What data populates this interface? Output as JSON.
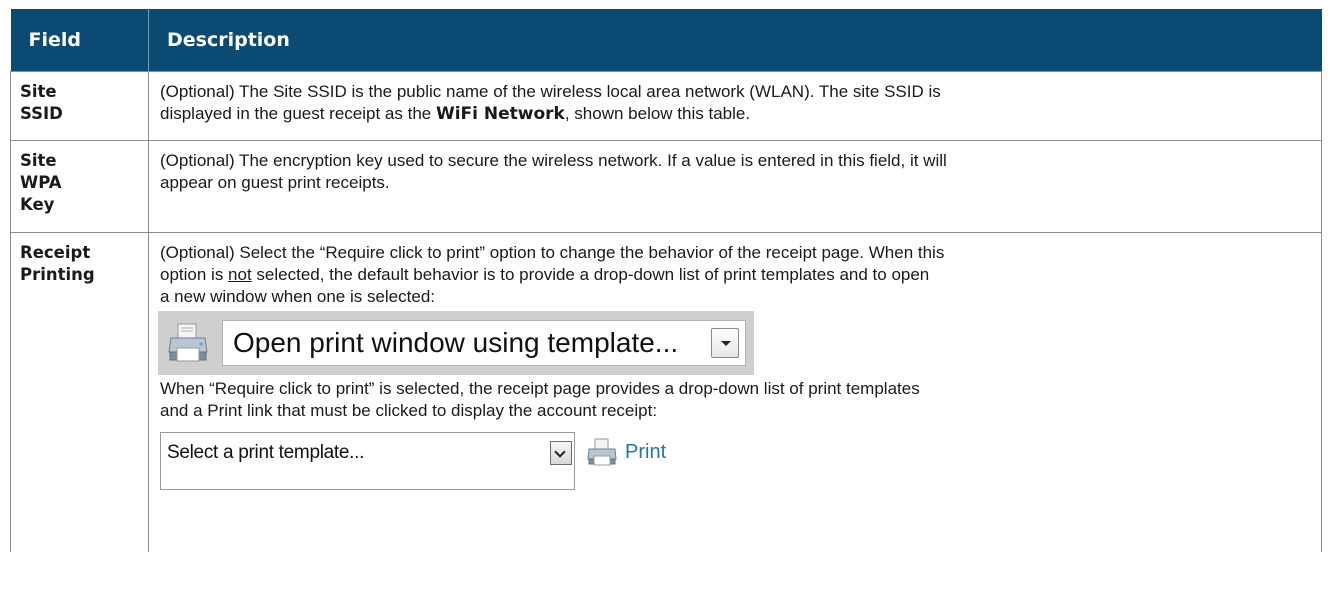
{
  "table": {
    "headers": {
      "field": "Field",
      "description": "Description"
    },
    "rows": [
      {
        "field_lines": [
          "Site",
          "SSID"
        ],
        "desc": {
          "line1": "(Optional) The Site SSID is the public name of the wireless local area network (WLAN). The site SSID is",
          "line2_pre": "displayed in the guest receipt as the ",
          "line2_bold": "WiFi Network",
          "line2_post": ", shown below this table."
        }
      },
      {
        "field_lines": [
          "Site",
          "WPA",
          "Key"
        ],
        "desc": {
          "line1": "(Optional) The encryption key used to secure the wireless network. If a value is entered in this field, it will",
          "line2": "appear on guest print receipts."
        }
      },
      {
        "field_lines": [
          "Receipt",
          "Printing"
        ],
        "desc": {
          "line1": "(Optional) Select the “Require click to print” option to change the behavior of the receipt page. When this",
          "line2_pre": "option is ",
          "line2_underline": "not",
          "line2_post": " selected, the default behavior is to provide a drop-down list of print templates and to open",
          "line3": "a new window when one is selected:",
          "example1_select_value": "Open print window using template...",
          "line4": "When “Require click to print” is selected, the receipt page provides a drop-down list of print templates",
          "line5": "and a Print link that must be clicked to display the account receipt:",
          "example2_select_value": "Select a print template...",
          "example2_link": "Print"
        }
      }
    ]
  },
  "icons": {
    "printer": "printer-icon",
    "dropdown_arrow": "chevron-down-icon"
  },
  "colors": {
    "header_bg": "#0b4a72",
    "header_text": "#ffffff",
    "link": "#2a6ebb",
    "example_bg": "#cfcfcf"
  }
}
